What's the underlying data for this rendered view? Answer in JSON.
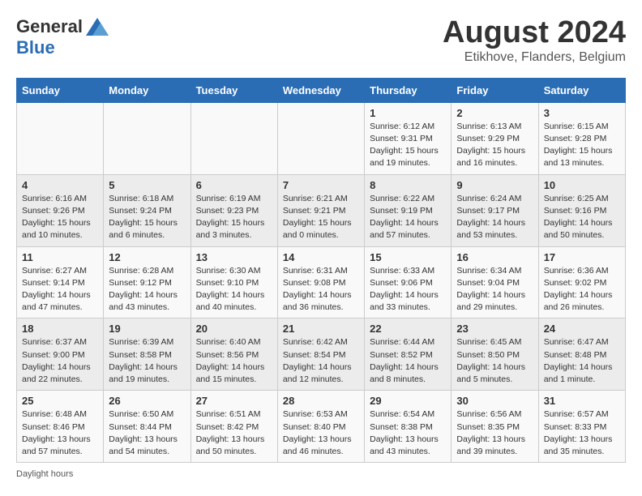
{
  "header": {
    "logo_general": "General",
    "logo_blue": "Blue",
    "month_title": "August 2024",
    "subtitle": "Etikhove, Flanders, Belgium"
  },
  "days_of_week": [
    "Sunday",
    "Monday",
    "Tuesday",
    "Wednesday",
    "Thursday",
    "Friday",
    "Saturday"
  ],
  "weeks": [
    [
      {
        "day": "",
        "info": ""
      },
      {
        "day": "",
        "info": ""
      },
      {
        "day": "",
        "info": ""
      },
      {
        "day": "",
        "info": ""
      },
      {
        "day": "1",
        "info": "Sunrise: 6:12 AM\nSunset: 9:31 PM\nDaylight: 15 hours\nand 19 minutes."
      },
      {
        "day": "2",
        "info": "Sunrise: 6:13 AM\nSunset: 9:29 PM\nDaylight: 15 hours\nand 16 minutes."
      },
      {
        "day": "3",
        "info": "Sunrise: 6:15 AM\nSunset: 9:28 PM\nDaylight: 15 hours\nand 13 minutes."
      }
    ],
    [
      {
        "day": "4",
        "info": "Sunrise: 6:16 AM\nSunset: 9:26 PM\nDaylight: 15 hours\nand 10 minutes."
      },
      {
        "day": "5",
        "info": "Sunrise: 6:18 AM\nSunset: 9:24 PM\nDaylight: 15 hours\nand 6 minutes."
      },
      {
        "day": "6",
        "info": "Sunrise: 6:19 AM\nSunset: 9:23 PM\nDaylight: 15 hours\nand 3 minutes."
      },
      {
        "day": "7",
        "info": "Sunrise: 6:21 AM\nSunset: 9:21 PM\nDaylight: 15 hours\nand 0 minutes."
      },
      {
        "day": "8",
        "info": "Sunrise: 6:22 AM\nSunset: 9:19 PM\nDaylight: 14 hours\nand 57 minutes."
      },
      {
        "day": "9",
        "info": "Sunrise: 6:24 AM\nSunset: 9:17 PM\nDaylight: 14 hours\nand 53 minutes."
      },
      {
        "day": "10",
        "info": "Sunrise: 6:25 AM\nSunset: 9:16 PM\nDaylight: 14 hours\nand 50 minutes."
      }
    ],
    [
      {
        "day": "11",
        "info": "Sunrise: 6:27 AM\nSunset: 9:14 PM\nDaylight: 14 hours\nand 47 minutes."
      },
      {
        "day": "12",
        "info": "Sunrise: 6:28 AM\nSunset: 9:12 PM\nDaylight: 14 hours\nand 43 minutes."
      },
      {
        "day": "13",
        "info": "Sunrise: 6:30 AM\nSunset: 9:10 PM\nDaylight: 14 hours\nand 40 minutes."
      },
      {
        "day": "14",
        "info": "Sunrise: 6:31 AM\nSunset: 9:08 PM\nDaylight: 14 hours\nand 36 minutes."
      },
      {
        "day": "15",
        "info": "Sunrise: 6:33 AM\nSunset: 9:06 PM\nDaylight: 14 hours\nand 33 minutes."
      },
      {
        "day": "16",
        "info": "Sunrise: 6:34 AM\nSunset: 9:04 PM\nDaylight: 14 hours\nand 29 minutes."
      },
      {
        "day": "17",
        "info": "Sunrise: 6:36 AM\nSunset: 9:02 PM\nDaylight: 14 hours\nand 26 minutes."
      }
    ],
    [
      {
        "day": "18",
        "info": "Sunrise: 6:37 AM\nSunset: 9:00 PM\nDaylight: 14 hours\nand 22 minutes."
      },
      {
        "day": "19",
        "info": "Sunrise: 6:39 AM\nSunset: 8:58 PM\nDaylight: 14 hours\nand 19 minutes."
      },
      {
        "day": "20",
        "info": "Sunrise: 6:40 AM\nSunset: 8:56 PM\nDaylight: 14 hours\nand 15 minutes."
      },
      {
        "day": "21",
        "info": "Sunrise: 6:42 AM\nSunset: 8:54 PM\nDaylight: 14 hours\nand 12 minutes."
      },
      {
        "day": "22",
        "info": "Sunrise: 6:44 AM\nSunset: 8:52 PM\nDaylight: 14 hours\nand 8 minutes."
      },
      {
        "day": "23",
        "info": "Sunrise: 6:45 AM\nSunset: 8:50 PM\nDaylight: 14 hours\nand 5 minutes."
      },
      {
        "day": "24",
        "info": "Sunrise: 6:47 AM\nSunset: 8:48 PM\nDaylight: 14 hours\nand 1 minute."
      }
    ],
    [
      {
        "day": "25",
        "info": "Sunrise: 6:48 AM\nSunset: 8:46 PM\nDaylight: 13 hours\nand 57 minutes."
      },
      {
        "day": "26",
        "info": "Sunrise: 6:50 AM\nSunset: 8:44 PM\nDaylight: 13 hours\nand 54 minutes."
      },
      {
        "day": "27",
        "info": "Sunrise: 6:51 AM\nSunset: 8:42 PM\nDaylight: 13 hours\nand 50 minutes."
      },
      {
        "day": "28",
        "info": "Sunrise: 6:53 AM\nSunset: 8:40 PM\nDaylight: 13 hours\nand 46 minutes."
      },
      {
        "day": "29",
        "info": "Sunrise: 6:54 AM\nSunset: 8:38 PM\nDaylight: 13 hours\nand 43 minutes."
      },
      {
        "day": "30",
        "info": "Sunrise: 6:56 AM\nSunset: 8:35 PM\nDaylight: 13 hours\nand 39 minutes."
      },
      {
        "day": "31",
        "info": "Sunrise: 6:57 AM\nSunset: 8:33 PM\nDaylight: 13 hours\nand 35 minutes."
      }
    ]
  ],
  "footer": {
    "daylight_label": "Daylight hours"
  }
}
